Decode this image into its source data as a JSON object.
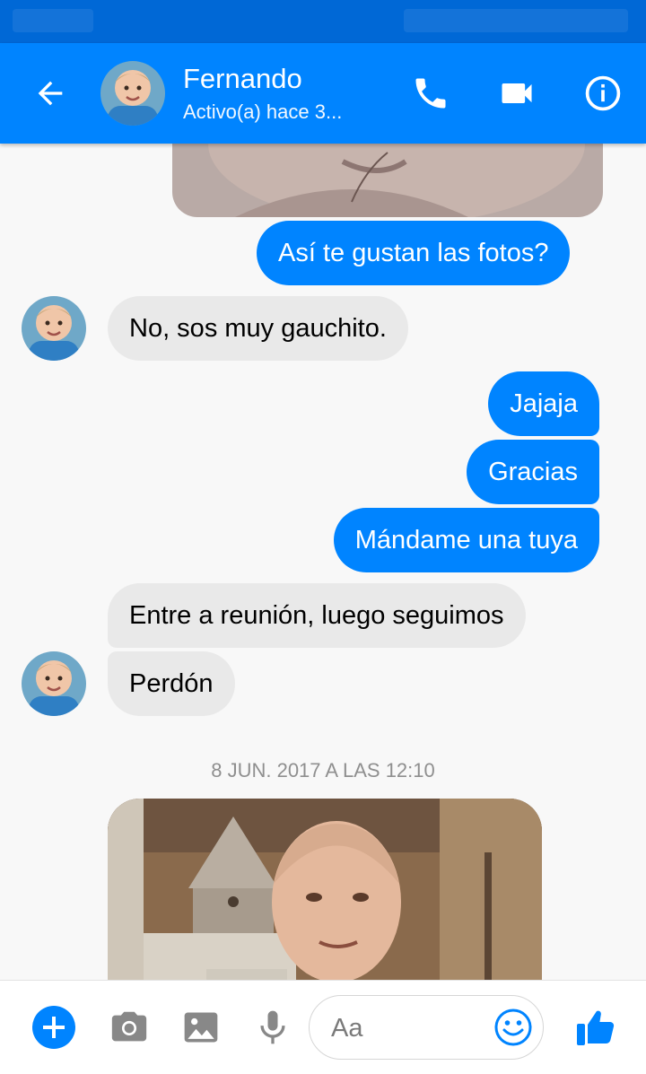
{
  "header": {
    "name": "Fernando",
    "status": "Activo(a) hace 3...",
    "icons": [
      "back-arrow-icon",
      "phone-icon",
      "video-camera-icon",
      "info-icon"
    ]
  },
  "messages": [
    {
      "from": "me",
      "text": "Así te gustan las fotos?"
    },
    {
      "from": "contact",
      "text": "No, sos muy gauchito."
    },
    {
      "from": "me",
      "text": "Jajaja"
    },
    {
      "from": "me",
      "text": "Gracias"
    },
    {
      "from": "me",
      "text": "Mándame una tuya"
    },
    {
      "from": "contact",
      "text": "Entre a reunión, luego seguimos"
    },
    {
      "from": "contact",
      "text": "Perdón"
    }
  ],
  "timestamp": "8 JUN. 2017 A LAS 12:10",
  "composer": {
    "placeholder": "Aa",
    "icons": [
      "plus-icon",
      "camera-icon",
      "gallery-icon",
      "microphone-icon",
      "emoji-icon",
      "thumbs-up-icon"
    ]
  },
  "colors": {
    "accent": "#0084ff",
    "status_bar": "#0068d6",
    "incoming_bubble": "#e9e9e9",
    "background": "#f8f8f8"
  }
}
